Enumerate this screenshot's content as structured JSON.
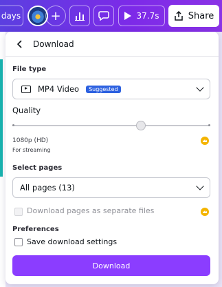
{
  "toolbar": {
    "days_label": "days",
    "plus_label": "+",
    "timer_label": "37.7s",
    "share_label": "Share"
  },
  "panel": {
    "title": "Download",
    "file_type": {
      "label": "File type",
      "value": "MP4 Video",
      "badge": "Suggested"
    },
    "quality": {
      "label": "Quality",
      "slider_fraction": 0.65,
      "resolution": "1080p (HD)",
      "subtitle": "For streaming"
    },
    "pages": {
      "label": "Select pages",
      "value": "All pages (13)"
    },
    "separate_files_label": "Download pages as separate files",
    "preferences": {
      "label": "Preferences",
      "save_settings_label": "Save download settings"
    },
    "download_button": "Download"
  },
  "colors": {
    "accent": "#8b3dff",
    "badge": "#2d61e0",
    "crown": "#f4b400"
  },
  "icons": [
    "back-arrow-icon",
    "avatar",
    "plus-icon",
    "bar-chart-icon",
    "comment-icon",
    "play-icon",
    "share-icon",
    "video-file-icon",
    "chevron-down-icon",
    "crown-icon"
  ]
}
